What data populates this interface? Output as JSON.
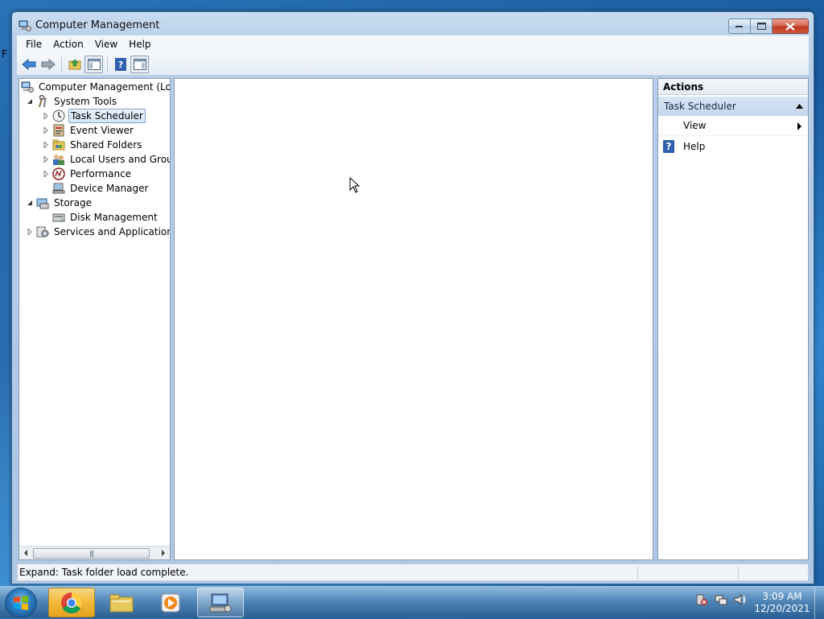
{
  "window": {
    "title": "Computer Management"
  },
  "menu": {
    "file": "File",
    "action": "Action",
    "view": "View",
    "help": "Help"
  },
  "tree": {
    "root": "Computer Management (Local",
    "system_tools": "System Tools",
    "task_scheduler": "Task Scheduler",
    "event_viewer": "Event Viewer",
    "shared_folders": "Shared Folders",
    "local_users": "Local Users and Groups",
    "performance": "Performance",
    "device_manager": "Device Manager",
    "storage": "Storage",
    "disk_management": "Disk Management",
    "services_apps": "Services and Applications",
    "selected": "Task Scheduler"
  },
  "actions": {
    "header": "Actions",
    "section": "Task Scheduler",
    "items": [
      {
        "label": "View",
        "icon": "none",
        "has_submenu": true
      },
      {
        "label": "Help",
        "icon": "help-icon",
        "has_submenu": false
      }
    ]
  },
  "status": {
    "prefix": "Expand:",
    "text": "Task folder load complete."
  },
  "taskbar": {
    "apps": [
      "chrome-icon",
      "explorer-folder-icon",
      "media-player-icon",
      "computer-management-icon"
    ],
    "active_app": "chrome-icon",
    "time": "3:09 AM",
    "date": "12/20/2021"
  },
  "colors": {
    "accent": "#2f5fae",
    "selection": "#d6e5f7",
    "section_bg": "#c3d6ec"
  },
  "desktop": {
    "edge_letter": "F"
  }
}
